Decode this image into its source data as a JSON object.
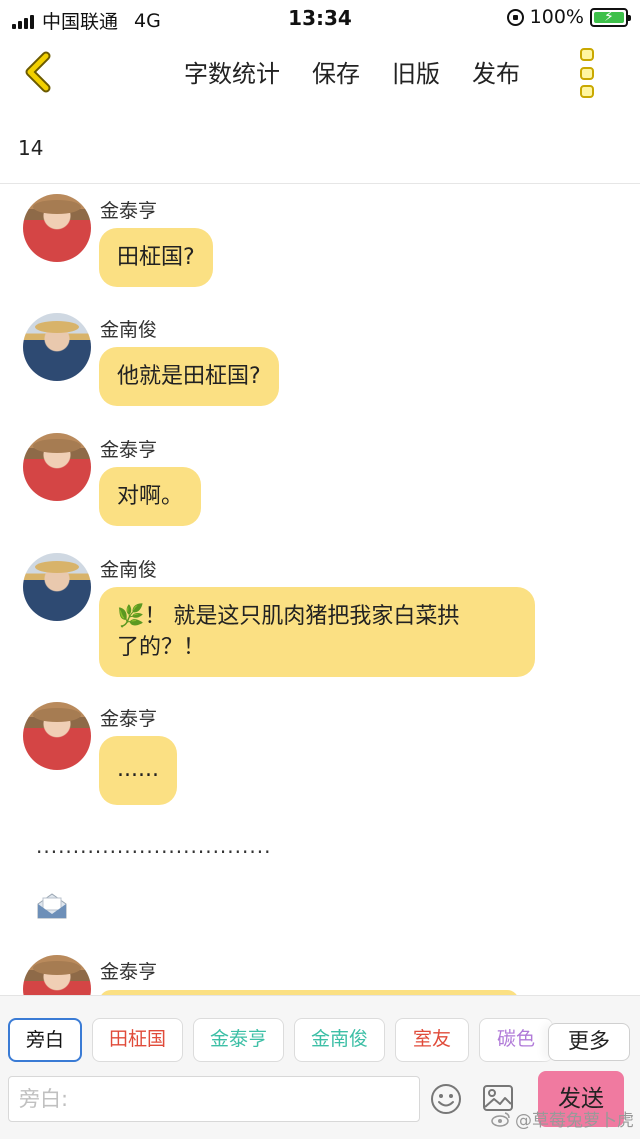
{
  "status_bar": {
    "carrier": "中国联通",
    "network": "4G",
    "time": "13:34",
    "battery": "100%"
  },
  "toolbar": {
    "items": [
      "字数统计",
      "保存",
      "旧版",
      "发布"
    ]
  },
  "word_count": "14",
  "messages": [
    {
      "sender": "金泰亨",
      "text": "田柾国?"
    },
    {
      "sender": "金南俊",
      "text": "他就是田柾国?"
    },
    {
      "sender": "金泰亨",
      "text": "对啊。"
    },
    {
      "sender": "金南俊",
      "text_line1": "🌿！ 就是这只肌肉猪把我家白菜拱",
      "text_line2": "了的？！"
    },
    {
      "sender": "金泰亨",
      "text": "......"
    },
    {
      "sender": "金泰亨"
    }
  ],
  "narration_line": "................................",
  "character_chips": [
    {
      "label": "旁白",
      "color": "#111111"
    },
    {
      "label": "田柾国",
      "color": "#e04b3a"
    },
    {
      "label": "金泰亨",
      "color": "#3dbfa6"
    },
    {
      "label": "金南俊",
      "color": "#3dbfa6"
    },
    {
      "label": "室友",
      "color": "#e04b3a"
    },
    {
      "label": "碳色",
      "color": "#b07ad8"
    }
  ],
  "more_button": "更多",
  "input": {
    "placeholder": "旁白:"
  },
  "send_button": "发送",
  "watermark": "@草莓兔萝卜虎",
  "colors": {
    "bubble": "#fbe083",
    "send": "#f07aa0",
    "active_chip_border": "#3a7bd5",
    "accent_icon": "#c9a800"
  }
}
